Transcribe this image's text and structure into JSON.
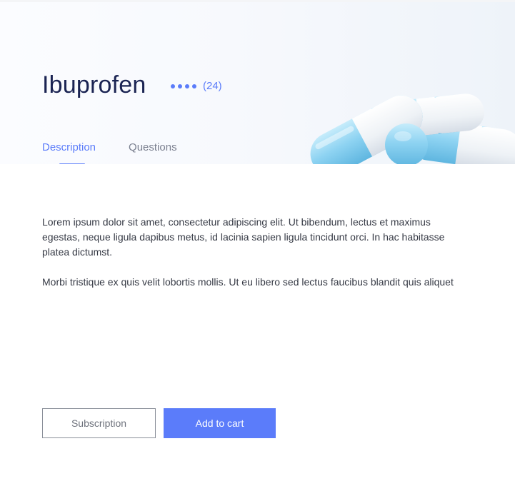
{
  "product": {
    "name": "Ibuprofen",
    "rating_count": "(24)",
    "rating_dots": 4
  },
  "tabs": [
    {
      "label": "Description",
      "active": true
    },
    {
      "label": "Questions",
      "active": false
    }
  ],
  "description": {
    "paragraphs": [
      "Lorem ipsum dolor sit amet, consectetur adipiscing elit. Ut bibendum, lectus et maximus egestas, neque ligula dapibus metus, id lacinia sapien ligula tincidunt orci. In hac habitasse platea dictumst.",
      "Morbi tristique ex quis velit lobortis mollis. Ut eu libero sed lectus faucibus blandit quis aliquet"
    ]
  },
  "actions": {
    "subscription_label": "Subscription",
    "add_to_cart_label": "Add to cart"
  },
  "colors": {
    "accent": "#5b7cfa",
    "title": "#1b2453",
    "capsule_blue": "#8fd0f0",
    "capsule_white": "#f2f5f8"
  },
  "icons": {
    "rating": "dot-rating-icon",
    "hero": "capsule-pills-image"
  }
}
